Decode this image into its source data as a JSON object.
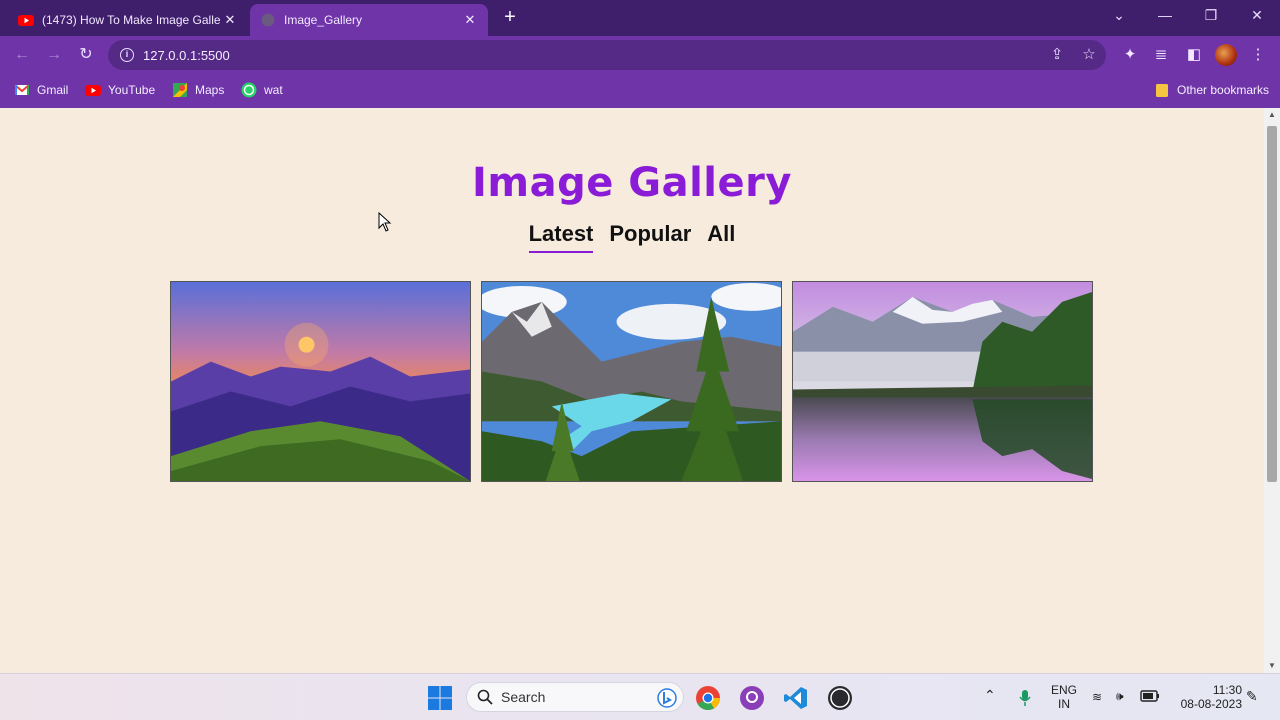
{
  "browser": {
    "tabs": [
      {
        "title": "(1473) How To Make Image Galle",
        "active": false
      },
      {
        "title": "Image_Gallery",
        "active": true
      }
    ],
    "url": "127.0.0.1:5500",
    "bookmarks": [
      {
        "label": "Gmail",
        "icon": "gmail-icon"
      },
      {
        "label": "YouTube",
        "icon": "youtube-icon"
      },
      {
        "label": "Maps",
        "icon": "maps-icon"
      },
      {
        "label": "wat",
        "icon": "whatsapp-icon"
      }
    ],
    "other_bookmarks": "Other bookmarks"
  },
  "page": {
    "title": "Image Gallery",
    "filters": [
      {
        "label": "Latest",
        "active": true
      },
      {
        "label": "Popular",
        "active": false
      },
      {
        "label": "All",
        "active": false
      }
    ],
    "images": [
      {
        "subject": "sunset over mountains"
      },
      {
        "subject": "turquoise mountain lake with pine trees"
      },
      {
        "subject": "misty mountain lake reflection"
      }
    ]
  },
  "taskbar": {
    "search_placeholder": "Search",
    "language": "ENG",
    "region": "IN",
    "time": "11:30",
    "date": "08-08-2023"
  }
}
